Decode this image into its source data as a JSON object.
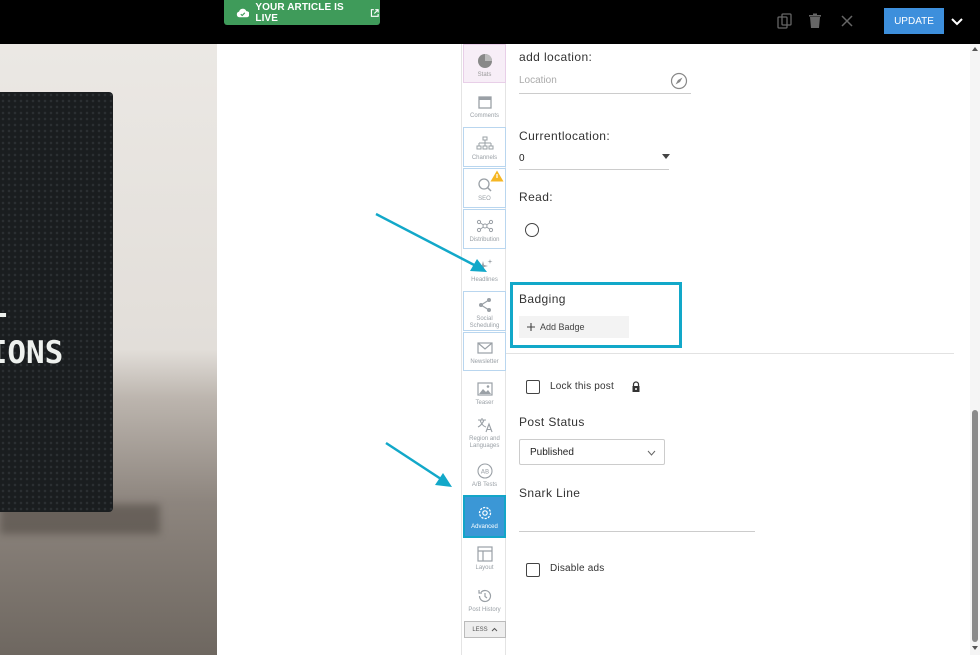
{
  "topbar": {
    "live_label": "YOUR ARTICLE IS LIVE",
    "update_label": "UPDATE"
  },
  "hero": {
    "board_text": "T\nO\nUL\nTIONS"
  },
  "rail": {
    "items": [
      {
        "label": "Stats",
        "icon": "pie-chart-icon"
      },
      {
        "label": "Comments",
        "icon": "calendar-icon"
      },
      {
        "label": "Channels",
        "icon": "sitemap-icon"
      },
      {
        "label": "SEO",
        "icon": "search-chart-icon"
      },
      {
        "label": "Distribution",
        "icon": "network-icon"
      },
      {
        "label": "Headlines",
        "icon": "sparkle-icon"
      },
      {
        "label": "Social Scheduling",
        "icon": "share-icon"
      },
      {
        "label": "Newsletter",
        "icon": "envelope-icon"
      },
      {
        "label": "Teaser",
        "icon": "image-icon"
      },
      {
        "label": "Region and Languages",
        "icon": "translate-icon"
      },
      {
        "label": "A/B Tests",
        "icon": "ab-icon"
      },
      {
        "label": "Advanced",
        "icon": "gear-icon"
      },
      {
        "label": "Layout",
        "icon": "layout-icon"
      },
      {
        "label": "Post History",
        "icon": "history-icon"
      }
    ],
    "less_label": "LESS"
  },
  "panel": {
    "add_location_label": "add location:",
    "location_placeholder": "Location",
    "current_location_label": "Currentlocation:",
    "current_location_value": "0",
    "read_label": "Read:",
    "badging_label": "Badging",
    "add_badge_label": "Add Badge",
    "lock_label": "Lock this post",
    "post_status_label": "Post Status",
    "post_status_value": "Published",
    "snark_line_label": "Snark Line",
    "disable_ads_label": "Disable ads"
  },
  "colors": {
    "live_green": "#3f9b5a",
    "update_blue": "#3d8fdc",
    "annotation_cyan": "#12a8c9",
    "active_blue": "#3b97d6"
  }
}
